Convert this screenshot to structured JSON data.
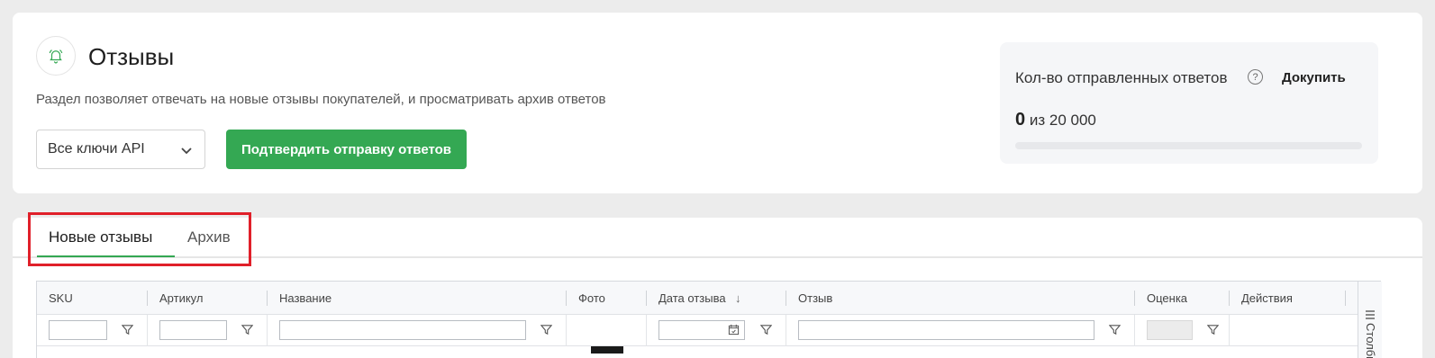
{
  "header": {
    "title": "Отзывы",
    "description": "Раздел позволяет отвечать на новые отзывы покупателей, и просматривать архив ответов",
    "api_select": "Все ключи API",
    "confirm_button": "Подтвердить отправку ответов"
  },
  "quota": {
    "label": "Кол-во отправленных ответов",
    "help": "?",
    "buy_link": "Докупить",
    "used": "0",
    "total_text": "из 20 000",
    "progress": 0
  },
  "tabs": [
    {
      "label": "Новые отзывы",
      "active": true
    },
    {
      "label": "Архив",
      "active": false
    }
  ],
  "table": {
    "columns": [
      "SKU",
      "Артикул",
      "Название",
      "Фото",
      "Дата отзыва",
      "Отзыв",
      "Оценка",
      "Действия"
    ],
    "sort_indicator": "↓",
    "columns_panel": "Столбцы"
  },
  "colors": {
    "accent": "#34a853",
    "highlight": "#e0202a"
  }
}
